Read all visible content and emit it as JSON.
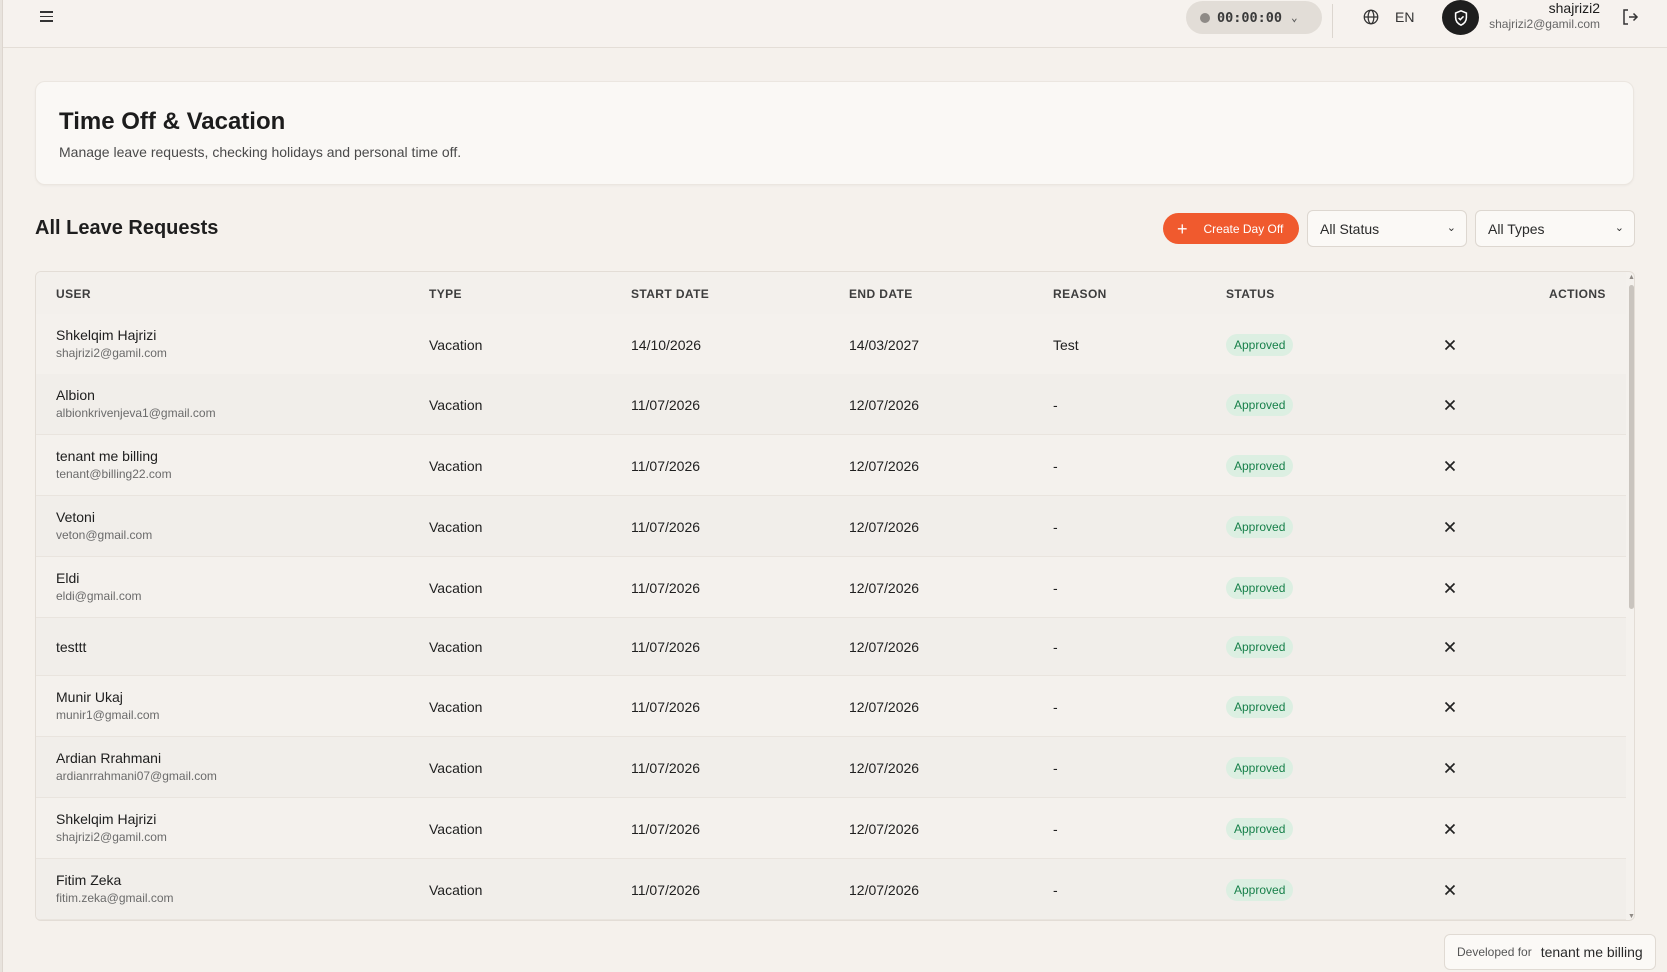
{
  "topbar": {
    "timer": "00:00:00",
    "language": "EN",
    "user_name": "shajrizi2",
    "user_email": "shajrizi2@gamil.com"
  },
  "header": {
    "title": "Time Off & Vacation",
    "subtitle": "Manage leave requests, checking holidays and personal time off."
  },
  "section": {
    "title": "All Leave Requests",
    "create_label": "Create Day Off",
    "status_filter": "All Status",
    "type_filter": "All Types"
  },
  "table": {
    "columns": [
      "USER",
      "TYPE",
      "START DATE",
      "END DATE",
      "REASON",
      "STATUS",
      "ACTIONS"
    ],
    "rows": [
      {
        "name": "Shkelqim Hajrizi",
        "email": "shajrizi2@gamil.com",
        "type": "Vacation",
        "start": "14/10/2026",
        "end": "14/03/2027",
        "reason": "Test",
        "status": "Approved"
      },
      {
        "name": "Albion",
        "email": "albionkrivenjeva1@gmail.com",
        "type": "Vacation",
        "start": "11/07/2026",
        "end": "12/07/2026",
        "reason": "-",
        "status": "Approved"
      },
      {
        "name": "tenant me billing",
        "email": "tenant@billing22.com",
        "type": "Vacation",
        "start": "11/07/2026",
        "end": "12/07/2026",
        "reason": "-",
        "status": "Approved"
      },
      {
        "name": "Vetoni",
        "email": "veton@gmail.com",
        "type": "Vacation",
        "start": "11/07/2026",
        "end": "12/07/2026",
        "reason": "-",
        "status": "Approved"
      },
      {
        "name": "Eldi",
        "email": "eldi@gmail.com",
        "type": "Vacation",
        "start": "11/07/2026",
        "end": "12/07/2026",
        "reason": "-",
        "status": "Approved"
      },
      {
        "name": "testtt",
        "email": "",
        "type": "Vacation",
        "start": "11/07/2026",
        "end": "12/07/2026",
        "reason": "-",
        "status": "Approved"
      },
      {
        "name": "Munir Ukaj",
        "email": "munir1@gmail.com",
        "type": "Vacation",
        "start": "11/07/2026",
        "end": "12/07/2026",
        "reason": "-",
        "status": "Approved"
      },
      {
        "name": "Ardian Rrahmani",
        "email": "ardianrrahmani07@gmail.com",
        "type": "Vacation",
        "start": "11/07/2026",
        "end": "12/07/2026",
        "reason": "-",
        "status": "Approved"
      },
      {
        "name": "Shkelqim Hajrizi",
        "email": "shajrizi2@gamil.com",
        "type": "Vacation",
        "start": "11/07/2026",
        "end": "12/07/2026",
        "reason": "-",
        "status": "Approved"
      },
      {
        "name": "Fitim Zeka",
        "email": "fitim.zeka@gmail.com",
        "type": "Vacation",
        "start": "11/07/2026",
        "end": "12/07/2026",
        "reason": "-",
        "status": "Approved"
      }
    ]
  },
  "footer": {
    "developed_label": "Developed for",
    "developed_value": "tenant me billing"
  },
  "colors": {
    "accent": "#f05a2e",
    "approved_bg": "#dcefe2",
    "approved_text": "#17804a"
  }
}
